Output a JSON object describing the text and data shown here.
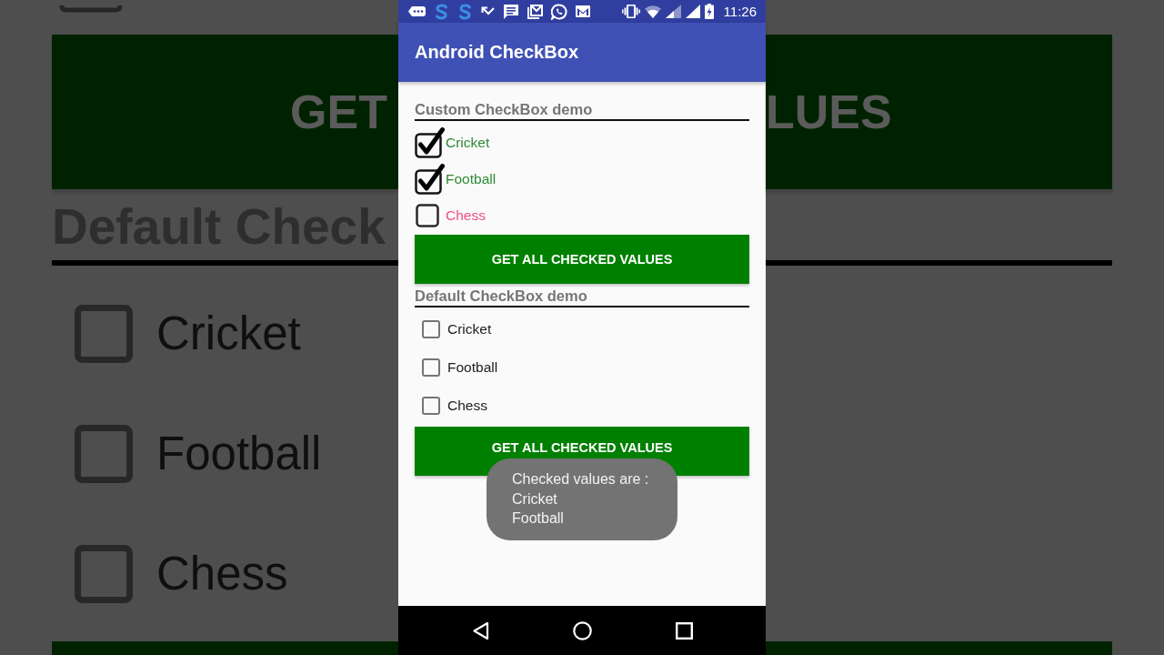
{
  "backdrop": {
    "left_button_text": "GET",
    "right_button_text": "LUES",
    "heading": "Default Check",
    "options": [
      {
        "label": "Cricket",
        "checked": false
      },
      {
        "label": "Football",
        "checked": false
      },
      {
        "label": "Chess",
        "checked": false
      }
    ]
  },
  "status_bar": {
    "time": "11:26"
  },
  "app_bar": {
    "title": "Android CheckBox"
  },
  "custom_section": {
    "heading": "Custom CheckBox demo",
    "options": [
      {
        "label": "Cricket",
        "checked": true
      },
      {
        "label": "Football",
        "checked": true
      },
      {
        "label": "Chess",
        "checked": false
      }
    ],
    "button": "GET ALL CHECKED VALUES"
  },
  "default_section": {
    "heading": "Default CheckBox demo",
    "options": [
      {
        "label": "Cricket",
        "checked": false
      },
      {
        "label": "Football",
        "checked": false
      },
      {
        "label": "Chess",
        "checked": false
      }
    ],
    "button": "GET ALL CHECKED VALUES"
  },
  "toast": {
    "message": "Checked values are :\nCricket\nFootball"
  }
}
